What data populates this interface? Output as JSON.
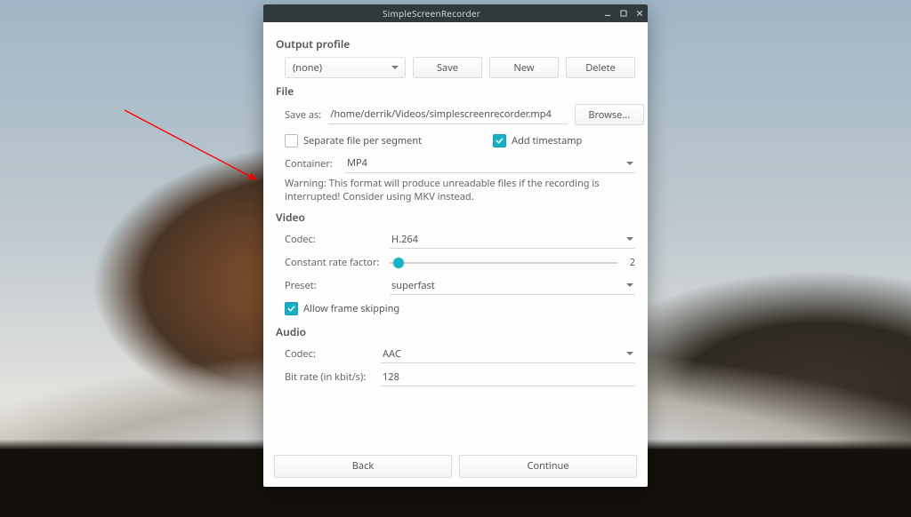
{
  "window": {
    "title": "SimpleScreenRecorder"
  },
  "output_profile": {
    "section_label": "Output profile",
    "selected": "(none)",
    "save_label": "Save",
    "new_label": "New",
    "delete_label": "Delete"
  },
  "file": {
    "section_label": "File",
    "save_as_label": "Save as:",
    "save_as_value": "/home/derrik/Videos/simplescreenrecorder.mp4",
    "browse_label": "Browse...",
    "separate_segment_label": "Separate file per segment",
    "separate_segment_checked": false,
    "add_timestamp_label": "Add timestamp",
    "add_timestamp_checked": true,
    "container_label": "Container:",
    "container_value": "MP4",
    "warning": "Warning: This format will produce unreadable files if the recording is interrupted! Consider using MKV instead."
  },
  "video": {
    "section_label": "Video",
    "codec_label": "Codec:",
    "codec_value": "H.264",
    "crf_label": "Constant rate factor:",
    "crf_value": "2",
    "crf_slider_percent": 4,
    "preset_label": "Preset:",
    "preset_value": "superfast",
    "allow_frame_skipping_label": "Allow frame skipping",
    "allow_frame_skipping_checked": true
  },
  "audio": {
    "section_label": "Audio",
    "codec_label": "Codec:",
    "codec_value": "AAC",
    "bitrate_label": "Bit rate (in kbit/s):",
    "bitrate_value": "128"
  },
  "footer": {
    "back_label": "Back",
    "continue_label": "Continue"
  }
}
